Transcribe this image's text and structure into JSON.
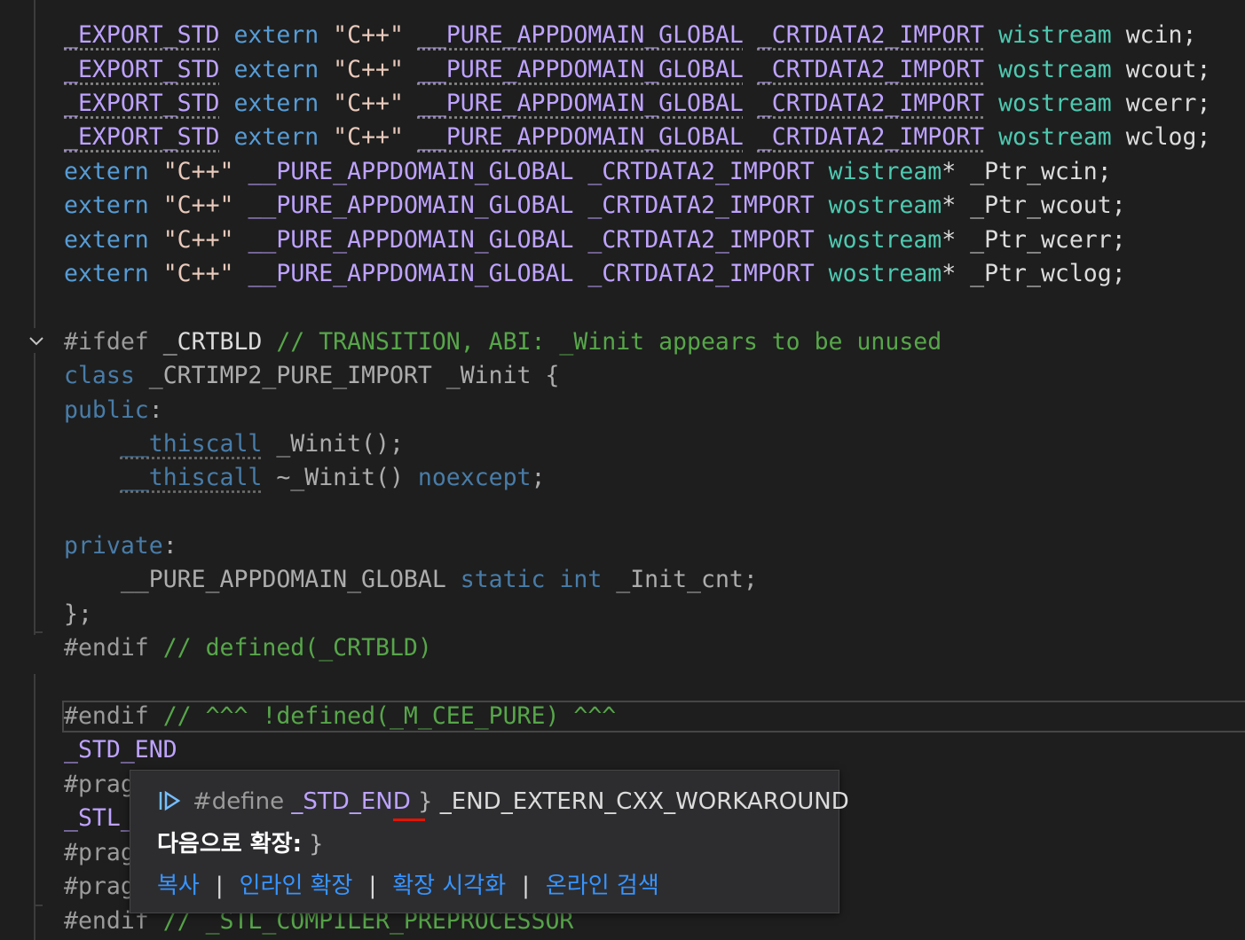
{
  "editor": {
    "lines": [
      {
        "segs": [
          {
            "c": "mac squig",
            "t": "_EXPORT_STD"
          },
          {
            "c": "plain",
            "t": " "
          },
          {
            "c": "kw",
            "t": "extern"
          },
          {
            "c": "plain",
            "t": " "
          },
          {
            "c": "str",
            "t": "\"C++\""
          },
          {
            "c": "plain",
            "t": " "
          },
          {
            "c": "mac squig",
            "t": "__PURE_APPDOMAIN_GLOBAL"
          },
          {
            "c": "plain",
            "t": " "
          },
          {
            "c": "mac squig",
            "t": "_CRTDATA2_IMPORT"
          },
          {
            "c": "plain",
            "t": " "
          },
          {
            "c": "typ",
            "t": "wistream"
          },
          {
            "c": "plain",
            "t": " wcin;"
          }
        ]
      },
      {
        "segs": [
          {
            "c": "mac squig",
            "t": "_EXPORT_STD"
          },
          {
            "c": "plain",
            "t": " "
          },
          {
            "c": "kw",
            "t": "extern"
          },
          {
            "c": "plain",
            "t": " "
          },
          {
            "c": "str",
            "t": "\"C++\""
          },
          {
            "c": "plain",
            "t": " "
          },
          {
            "c": "mac squig",
            "t": "__PURE_APPDOMAIN_GLOBAL"
          },
          {
            "c": "plain",
            "t": " "
          },
          {
            "c": "mac squig",
            "t": "_CRTDATA2_IMPORT"
          },
          {
            "c": "plain",
            "t": " "
          },
          {
            "c": "typ",
            "t": "wostream"
          },
          {
            "c": "plain",
            "t": " wcout;"
          }
        ]
      },
      {
        "segs": [
          {
            "c": "mac squig",
            "t": "_EXPORT_STD"
          },
          {
            "c": "plain",
            "t": " "
          },
          {
            "c": "kw",
            "t": "extern"
          },
          {
            "c": "plain",
            "t": " "
          },
          {
            "c": "str",
            "t": "\"C++\""
          },
          {
            "c": "plain",
            "t": " "
          },
          {
            "c": "mac squig",
            "t": "__PURE_APPDOMAIN_GLOBAL"
          },
          {
            "c": "plain",
            "t": " "
          },
          {
            "c": "mac squig",
            "t": "_CRTDATA2_IMPORT"
          },
          {
            "c": "plain",
            "t": " "
          },
          {
            "c": "typ",
            "t": "wostream"
          },
          {
            "c": "plain",
            "t": " wcerr;"
          }
        ]
      },
      {
        "segs": [
          {
            "c": "mac squig",
            "t": "_EXPORT_STD"
          },
          {
            "c": "plain",
            "t": " "
          },
          {
            "c": "kw",
            "t": "extern"
          },
          {
            "c": "plain",
            "t": " "
          },
          {
            "c": "str",
            "t": "\"C++\""
          },
          {
            "c": "plain",
            "t": " "
          },
          {
            "c": "mac squig",
            "t": "__PURE_APPDOMAIN_GLOBAL"
          },
          {
            "c": "plain",
            "t": " "
          },
          {
            "c": "mac squig",
            "t": "_CRTDATA2_IMPORT"
          },
          {
            "c": "plain",
            "t": " "
          },
          {
            "c": "typ",
            "t": "wostream"
          },
          {
            "c": "plain",
            "t": " wclog;"
          }
        ]
      },
      {
        "segs": [
          {
            "c": "kw",
            "t": "extern"
          },
          {
            "c": "plain",
            "t": " "
          },
          {
            "c": "str",
            "t": "\"C++\""
          },
          {
            "c": "plain",
            "t": " "
          },
          {
            "c": "mac",
            "t": "__PURE_APPDOMAIN_GLOBAL"
          },
          {
            "c": "plain",
            "t": " "
          },
          {
            "c": "mac",
            "t": "_CRTDATA2_IMPORT"
          },
          {
            "c": "plain",
            "t": " "
          },
          {
            "c": "typ",
            "t": "wistream"
          },
          {
            "c": "plain",
            "t": "* _Ptr_wcin;"
          }
        ]
      },
      {
        "segs": [
          {
            "c": "kw",
            "t": "extern"
          },
          {
            "c": "plain",
            "t": " "
          },
          {
            "c": "str",
            "t": "\"C++\""
          },
          {
            "c": "plain",
            "t": " "
          },
          {
            "c": "mac",
            "t": "__PURE_APPDOMAIN_GLOBAL"
          },
          {
            "c": "plain",
            "t": " "
          },
          {
            "c": "mac",
            "t": "_CRTDATA2_IMPORT"
          },
          {
            "c": "plain",
            "t": " "
          },
          {
            "c": "typ",
            "t": "wostream"
          },
          {
            "c": "plain",
            "t": "* _Ptr_wcout;"
          }
        ]
      },
      {
        "segs": [
          {
            "c": "kw",
            "t": "extern"
          },
          {
            "c": "plain",
            "t": " "
          },
          {
            "c": "str",
            "t": "\"C++\""
          },
          {
            "c": "plain",
            "t": " "
          },
          {
            "c": "mac",
            "t": "__PURE_APPDOMAIN_GLOBAL"
          },
          {
            "c": "plain",
            "t": " "
          },
          {
            "c": "mac",
            "t": "_CRTDATA2_IMPORT"
          },
          {
            "c": "plain",
            "t": " "
          },
          {
            "c": "typ",
            "t": "wostream"
          },
          {
            "c": "plain",
            "t": "* _Ptr_wcerr;"
          }
        ]
      },
      {
        "segs": [
          {
            "c": "kw",
            "t": "extern"
          },
          {
            "c": "plain",
            "t": " "
          },
          {
            "c": "str",
            "t": "\"C++\""
          },
          {
            "c": "plain",
            "t": " "
          },
          {
            "c": "mac",
            "t": "__PURE_APPDOMAIN_GLOBAL"
          },
          {
            "c": "plain",
            "t": " "
          },
          {
            "c": "mac",
            "t": "_CRTDATA2_IMPORT"
          },
          {
            "c": "plain",
            "t": " "
          },
          {
            "c": "typ",
            "t": "wostream"
          },
          {
            "c": "plain",
            "t": "* _Ptr_wclog;"
          }
        ]
      },
      {
        "segs": []
      },
      {
        "segs": [
          {
            "c": "pre",
            "t": "#ifdef"
          },
          {
            "c": "plain",
            "t": " _CRTBLD "
          },
          {
            "c": "cmt",
            "t": "// TRANSITION, ABI: _Winit appears to be unused"
          }
        ]
      },
      {
        "segs": [
          {
            "c": "kw dim",
            "t": "class"
          },
          {
            "c": "plain dim",
            "t": " _CRTIMP2_PURE_IMPORT _Winit {"
          }
        ]
      },
      {
        "segs": [
          {
            "c": "kw dim",
            "t": "public"
          },
          {
            "c": "plain dim",
            "t": ":"
          }
        ]
      },
      {
        "segs": [
          {
            "c": "plain",
            "t": "    "
          },
          {
            "c": "kw dim squig",
            "t": "__thiscall"
          },
          {
            "c": "plain dim",
            "t": " _Winit();"
          }
        ]
      },
      {
        "segs": [
          {
            "c": "plain",
            "t": "    "
          },
          {
            "c": "kw dim squig",
            "t": "__thiscall"
          },
          {
            "c": "plain dim",
            "t": " ~_Winit() "
          },
          {
            "c": "kw dim",
            "t": "noexcept"
          },
          {
            "c": "plain dim",
            "t": ";"
          }
        ]
      },
      {
        "segs": []
      },
      {
        "segs": [
          {
            "c": "kw dim",
            "t": "private"
          },
          {
            "c": "plain dim",
            "t": ":"
          }
        ]
      },
      {
        "segs": [
          {
            "c": "plain",
            "t": "    "
          },
          {
            "c": "plain dim",
            "t": "__PURE_APPDOMAIN_GLOBAL "
          },
          {
            "c": "kw dim",
            "t": "static"
          },
          {
            "c": "plain dim",
            "t": " "
          },
          {
            "c": "kw dim",
            "t": "int"
          },
          {
            "c": "plain dim",
            "t": " _Init_cnt;"
          }
        ]
      },
      {
        "segs": [
          {
            "c": "plain dim",
            "t": "};"
          }
        ]
      },
      {
        "segs": [
          {
            "c": "pre",
            "t": "#endif"
          },
          {
            "c": "plain",
            "t": " "
          },
          {
            "c": "cmt",
            "t": "// defined(_CRTBLD)"
          }
        ]
      },
      {
        "segs": []
      },
      {
        "segs": [
          {
            "c": "pre",
            "t": "#endif"
          },
          {
            "c": "plain",
            "t": " "
          },
          {
            "c": "cmt",
            "t": "// ^^^ !defined(_M_CEE_PURE) ^^^"
          }
        ]
      },
      {
        "segs": [
          {
            "c": "mac",
            "t": "_STD_END"
          }
        ]
      },
      {
        "segs": [
          {
            "c": "pre",
            "t": "#prag"
          }
        ]
      },
      {
        "segs": [
          {
            "c": "mac",
            "t": "_STL_"
          }
        ]
      },
      {
        "segs": [
          {
            "c": "pre",
            "t": "#prag"
          }
        ]
      },
      {
        "segs": [
          {
            "c": "pre",
            "t": "#prag"
          }
        ]
      },
      {
        "segs": [
          {
            "c": "pre",
            "t": "#endif"
          },
          {
            "c": "plain",
            "t": " "
          },
          {
            "c": "cmt",
            "t": "// _STL_COMPILER_PREPROCESSOR"
          }
        ]
      }
    ]
  },
  "tooltip": {
    "icon": "macro-expand-icon",
    "define_kw": "#define",
    "macro_name": "_STD_END",
    "brace": "}",
    "definition": "_END_EXTERN_CXX_WORKAROUND",
    "expands_label": "다음으로 확장:",
    "expands_value": "}",
    "actions": [
      "복사",
      "인라인 확장",
      "확장 시각화",
      "온라인 검색"
    ],
    "separator": "|"
  },
  "colors": {
    "background": "#1e1e1e",
    "macro": "#bea3ff",
    "keyword": "#569cd6",
    "string": "#e8c9bb",
    "type": "#4ec9b0",
    "comment": "#57a64a",
    "link": "#3794ff"
  }
}
